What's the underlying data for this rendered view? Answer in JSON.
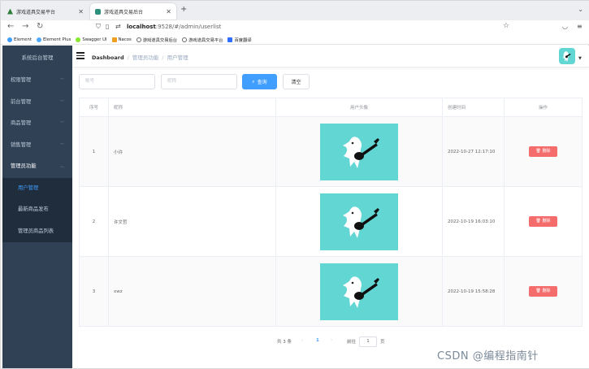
{
  "browser": {
    "tabs": [
      {
        "title": "游戏道具交易平台",
        "active": false
      },
      {
        "title": "游戏道具交易后台",
        "active": true
      }
    ],
    "url_host": "localhost",
    "url_path": ":9528/#/admin/userlist",
    "bookmarks": [
      "Element",
      "Element Plus",
      "Swagger UI",
      "Nacos",
      "游戏道具交易后台",
      "游戏道具交易平台",
      "百度翻译"
    ]
  },
  "sidebar": {
    "title": "系统后台管理",
    "items": [
      {
        "label": "权限管理"
      },
      {
        "label": "前台管理"
      },
      {
        "label": "商品管理"
      },
      {
        "label": "销售管理"
      },
      {
        "label": "管理员功能"
      }
    ],
    "subitems": [
      {
        "label": "用户管理",
        "active": true
      },
      {
        "label": "最新商品发布",
        "active": false
      },
      {
        "label": "管理员商品列表",
        "active": false
      }
    ]
  },
  "header": {
    "breadcrumb": [
      "Dashboard",
      "管理员功能",
      "用户管理"
    ]
  },
  "search": {
    "account_placeholder": "账号",
    "nickname_placeholder": "昵称",
    "search_label": "查询",
    "clear_label": "清空"
  },
  "table": {
    "columns": [
      "序号",
      "昵称",
      "用户头像",
      "创建时间",
      "操作"
    ],
    "rows": [
      {
        "index": "1",
        "nickname": "小许",
        "created": "2022-10-27 12:17:10",
        "action": "删除"
      },
      {
        "index": "2",
        "nickname": "许文哲",
        "created": "2022-10-19 16:03:10",
        "action": "删除"
      },
      {
        "index": "3",
        "nickname": "xwz",
        "created": "2022-10-19 15:58:28",
        "action": "删除"
      }
    ]
  },
  "pagination": {
    "total": "共 3 条",
    "current_page": "1",
    "goto_label": "前往",
    "goto_value": "1",
    "page_suffix": "页"
  },
  "watermark": "CSDN @编程指南针",
  "colors": {
    "sidebar_bg": "#304156",
    "submenu_bg": "#1f2d3d",
    "primary": "#409eff",
    "danger": "#f56c6c",
    "avatar_bg": "#62d6d3"
  }
}
